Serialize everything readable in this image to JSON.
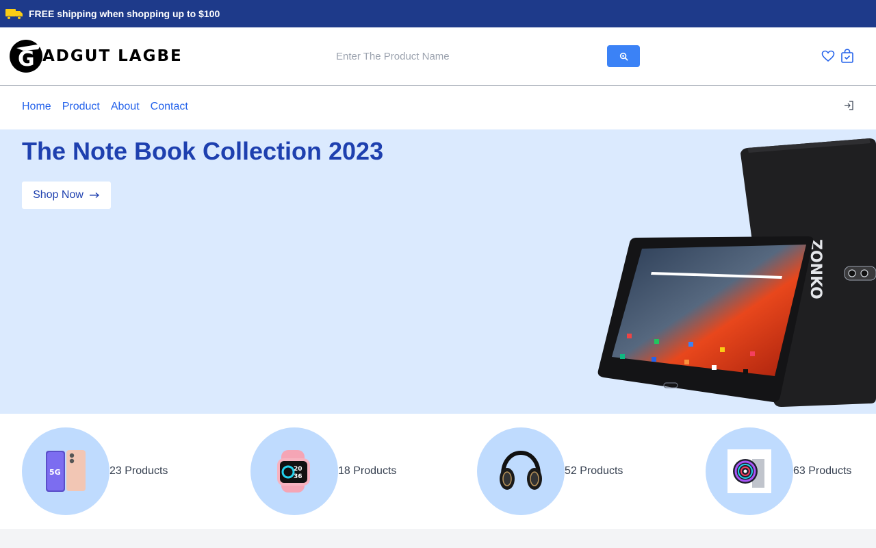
{
  "announcement": {
    "text": "FREE shipping when shopping up to $100",
    "icon": "truck-icon"
  },
  "brand": {
    "name": "ADGUT LAGBE",
    "logo_letter": "G"
  },
  "search": {
    "placeholder": "Enter The Product Name",
    "button_icon": "search-icon"
  },
  "header_icons": [
    "heart-icon",
    "shopping-bag-icon"
  ],
  "nav": {
    "links": [
      "Home",
      "Product",
      "About",
      "Contact"
    ],
    "login_icon": "login-icon"
  },
  "hero": {
    "title": "The Note Book Collection 2023",
    "cta_label": "Shop Now",
    "cta_icon": "arrow-right-icon",
    "tablet_brand": "ZONKO"
  },
  "categories": [
    {
      "icon": "smartphone-icon",
      "count_label": "23 Products"
    },
    {
      "icon": "smartwatch-icon",
      "count_label": "18 Products"
    },
    {
      "icon": "headphones-icon",
      "count_label": "52 Products"
    },
    {
      "icon": "cpu-cooler-icon",
      "count_label": "63 Products"
    }
  ],
  "colors": {
    "topbar": "#1e3a8a",
    "accent": "#3b82f6",
    "hero_bg": "#dbeafe",
    "title": "#1e40af",
    "link": "#2563eb",
    "category_circle": "#bfdbfe"
  }
}
